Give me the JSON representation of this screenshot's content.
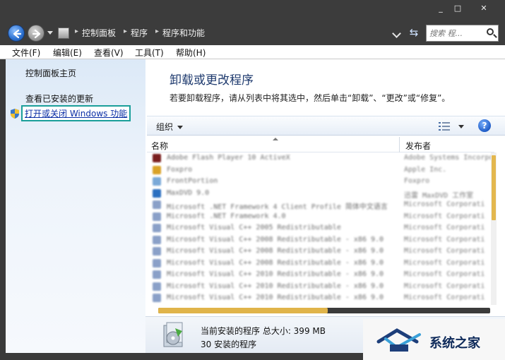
{
  "window": {
    "buttons": {
      "minimize": "_",
      "maximize": "□",
      "close": "✕"
    }
  },
  "address": {
    "breadcrumbs": [
      "控制面板",
      "程序",
      "程序和功能"
    ],
    "search_placeholder": "搜索 程..."
  },
  "menu": [
    "文件(F)",
    "编辑(E)",
    "查看(V)",
    "工具(T)",
    "帮助(H)"
  ],
  "sidebar": {
    "home": "控制面板主页",
    "view_updates": "查看已安装的更新",
    "windows_features": "打开或关闭 Windows 功能"
  },
  "main": {
    "title": "卸载或更改程序",
    "description": "若要卸载程序，请从列表中将其选中，然后单击“卸载”、“更改”或“修复”。",
    "toolbar": {
      "organize": "组织"
    },
    "columns": {
      "name": "名称",
      "publisher": "发布者"
    },
    "programs": [
      {
        "name": "Adobe Flash Player 10 ActiveX",
        "publisher": "Adobe Systems Incorpo",
        "color": "#7a1f1f"
      },
      {
        "name": "Foxpro",
        "publisher": "Apple Inc.",
        "color": "#d9a227"
      },
      {
        "name": "FrontPortion",
        "publisher": "Foxpro",
        "color": "#7aa9d8"
      },
      {
        "name": "MaxDVD 9.0",
        "publisher": "迅雷 MaxDVD 工作室",
        "color": "#2b6fc0"
      },
      {
        "name": "Microsoft .NET Framework 4 Client Profile 简体中文语言",
        "publisher": "Microsoft Corporati",
        "color": "#8aa0c8"
      },
      {
        "name": "Microsoft .NET Framework 4.0",
        "publisher": "Microsoft Corporati",
        "color": "#8aa0c8"
      },
      {
        "name": "Microsoft Visual C++ 2005 Redistributable",
        "publisher": "Microsoft Corporati",
        "color": "#8aa0c8"
      },
      {
        "name": "Microsoft Visual C++ 2008 Redistributable - x86 9.0",
        "publisher": "Microsoft Corporati",
        "color": "#8aa0c8"
      },
      {
        "name": "Microsoft Visual C++ 2008 Redistributable - x86 9.0",
        "publisher": "Microsoft Corporati",
        "color": "#8aa0c8"
      },
      {
        "name": "Microsoft Visual C++ 2008 Redistributable - x86 9.0",
        "publisher": "Microsoft Corporati",
        "color": "#8aa0c8"
      },
      {
        "name": "Microsoft Visual C++ 2010 Redistributable - x86 9.0",
        "publisher": "Microsoft Corporati",
        "color": "#8aa0c8"
      },
      {
        "name": "Microsoft Visual C++ 2010 Redistributable - x86 9.0",
        "publisher": "Microsoft Corporati",
        "color": "#8aa0c8"
      },
      {
        "name": "Microsoft Visual C++ 2010 Redistributable - x86 9.0",
        "publisher": "Microsoft Corporati",
        "color": "#8aa0c8"
      }
    ]
  },
  "status": {
    "line1": "当前安装的程序 总大小: 399 MB",
    "line2": "30 安装的程序"
  },
  "watermark": {
    "text": "系统之家"
  },
  "colors": {
    "highlight_border": "#1b9f9a",
    "scroll_accent": "#e0b44a",
    "link": "#0b2fa6"
  }
}
